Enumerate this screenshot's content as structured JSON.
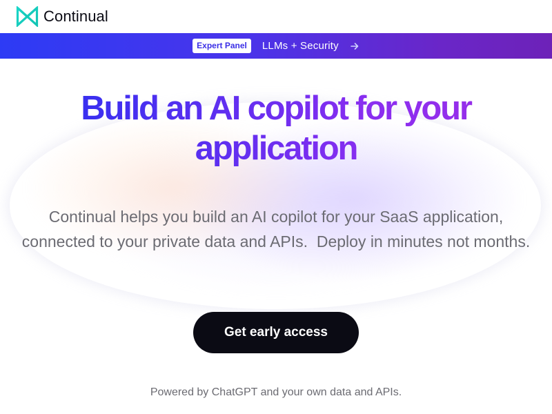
{
  "header": {
    "logo_text": "Continual",
    "logo_icon": "bowtie-logo-icon"
  },
  "banner": {
    "badge": "Expert Panel",
    "text": "LLMs + Security",
    "arrow_icon": "arrow-right-icon"
  },
  "hero": {
    "headline": "Build an AI copilot for your application",
    "subtitle": "Continual helps you build an AI copilot for your SaaS application, connected to your private data and APIs.  Deploy in minutes not months.",
    "cta_label": "Get early access",
    "powered_by": "Powered by ChatGPT and your own data and APIs."
  },
  "colors": {
    "brand_teal": "#19d3c5",
    "banner_start": "#2d3bf5",
    "banner_end": "#6d22b8",
    "headline_start": "#2e2ff0",
    "headline_end": "#9a2ee8",
    "cta_bg": "#0b0b14",
    "body_text": "#6b6b72"
  }
}
